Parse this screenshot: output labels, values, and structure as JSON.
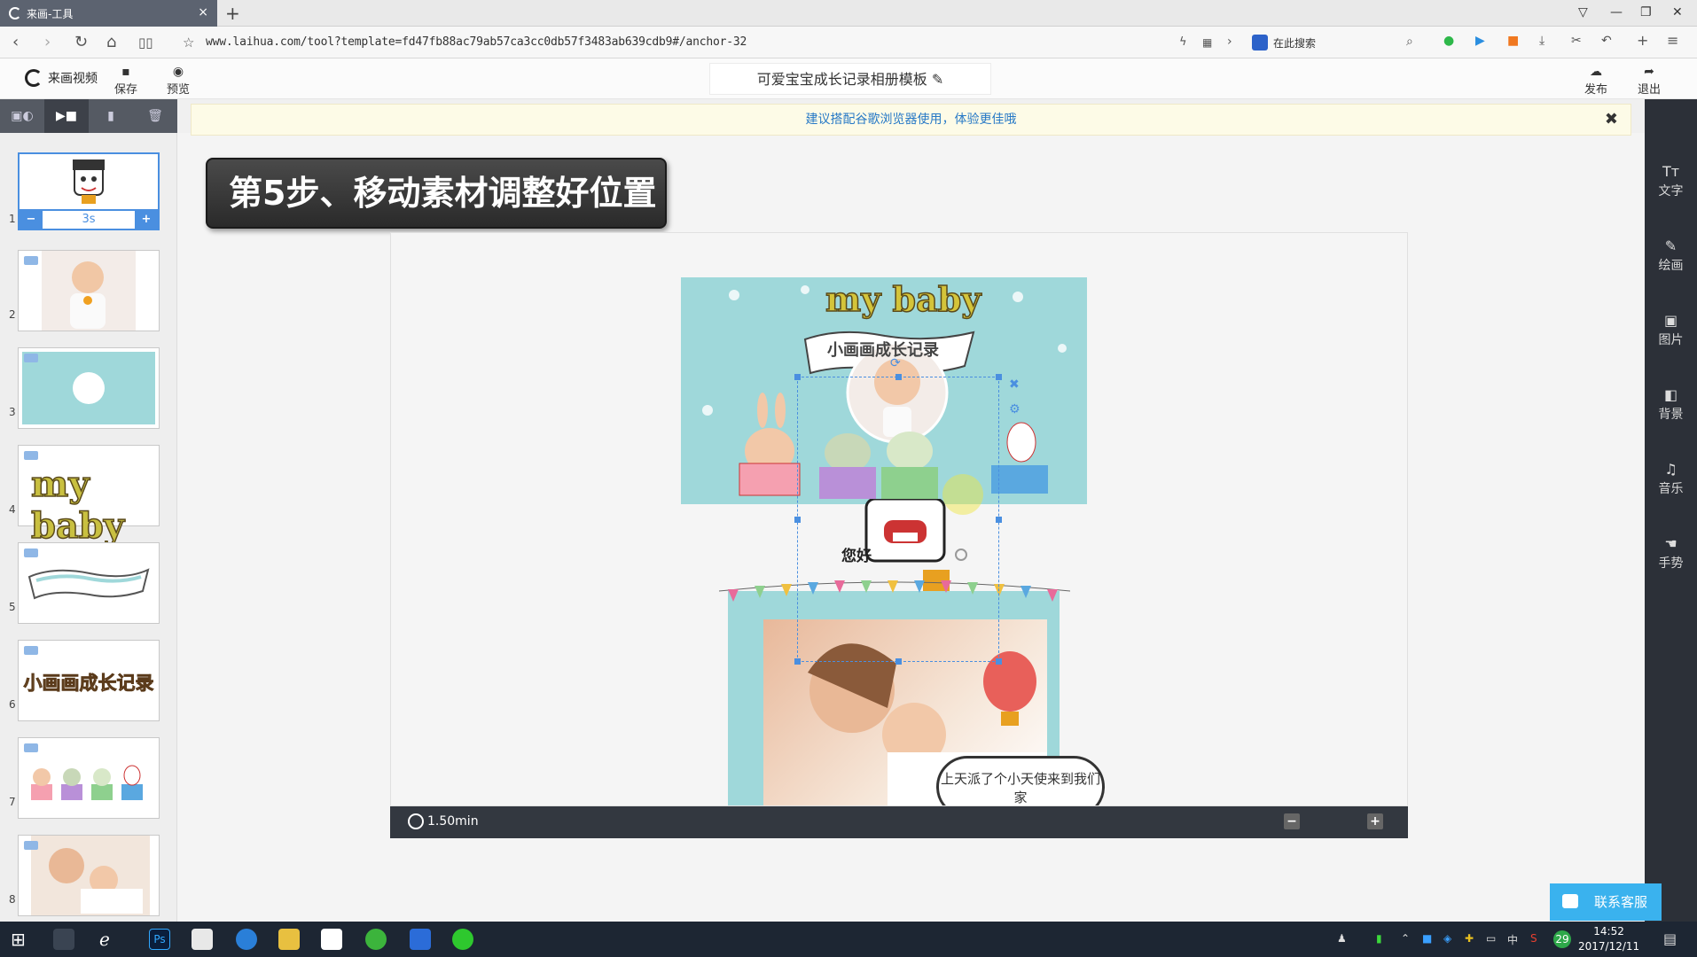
{
  "browser": {
    "tab_title": "来画-工具",
    "url": "www.laihua.com/tool?template=fd47fb88ac79ab57ca3cc0db57f3483ab639cdb9#/anchor-32",
    "search_placeholder": "在此搜索"
  },
  "header": {
    "logo_text": "来画视频",
    "save_label": "保存",
    "preview_label": "预览",
    "doc_title": "可爱宝宝成长记录相册模板",
    "publish_label": "发布",
    "exit_label": "退出"
  },
  "notice": {
    "text": "建议搭配谷歌浏览器使用，体验更佳哦",
    "close": "✖"
  },
  "slides": [
    {
      "num": "1"
    },
    {
      "num": "2"
    },
    {
      "num": "3"
    },
    {
      "num": "4",
      "text": "my baby"
    },
    {
      "num": "5"
    },
    {
      "num": "6",
      "text": "小画画成长记录"
    },
    {
      "num": "7"
    },
    {
      "num": "8"
    }
  ],
  "duration": {
    "minus": "−",
    "value": "3s",
    "plus": "+"
  },
  "right_tools": [
    {
      "label": "文字",
      "icon": "text-icon"
    },
    {
      "label": "绘画",
      "icon": "pen-icon"
    },
    {
      "label": "图片",
      "icon": "image-icon"
    },
    {
      "label": "背景",
      "icon": "background-icon"
    },
    {
      "label": "音乐",
      "icon": "music-icon"
    },
    {
      "label": "手势",
      "icon": "hand-icon"
    }
  ],
  "step_banner": "第5步、移动素材调整好位置",
  "stage": {
    "title_art": "my baby",
    "ribbon_text": "小画画成长记录",
    "greeting": "您好",
    "bubble_text": "上天派了个小天使来到我们家",
    "total_time": "1.50min"
  },
  "service_button": "联系客服",
  "taskbar": {
    "time": "14:52",
    "date": "2017/12/11",
    "ime": "中",
    "badge": "29"
  }
}
